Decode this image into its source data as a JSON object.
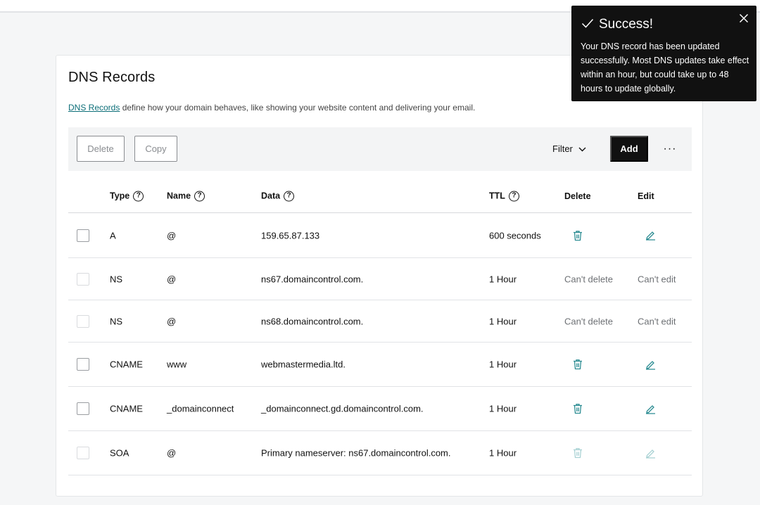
{
  "card": {
    "title": "DNS Records",
    "intro_link": "DNS Records",
    "intro_text": " define how your domain behaves, like showing your website content and delivering your email."
  },
  "toolbar": {
    "delete_label": "Delete",
    "copy_label": "Copy",
    "filter_label": "Filter",
    "add_label": "Add",
    "more_label": "···"
  },
  "table": {
    "headers": {
      "type": "Type",
      "name": "Name",
      "data": "Data",
      "ttl": "TTL",
      "delete": "Delete",
      "edit": "Edit"
    },
    "rows": [
      {
        "type": "A",
        "name": "@",
        "data": "159.65.87.133",
        "ttl": "600 seconds",
        "delete": "",
        "edit": ""
      },
      {
        "type": "NS",
        "name": "@",
        "data": "ns67.domaincontrol.com.",
        "ttl": "1 Hour",
        "delete": "Can't delete",
        "edit": "Can't edit"
      },
      {
        "type": "NS",
        "name": "@",
        "data": "ns68.domaincontrol.com.",
        "ttl": "1 Hour",
        "delete": "Can't delete",
        "edit": "Can't edit"
      },
      {
        "type": "CNAME",
        "name": "www",
        "data": "webmastermedia.ltd.",
        "ttl": "1 Hour",
        "delete": "",
        "edit": ""
      },
      {
        "type": "CNAME",
        "name": "_domainconnect",
        "data": "_domainconnect.gd.domaincontrol.com.",
        "ttl": "1 Hour",
        "delete": "",
        "edit": ""
      },
      {
        "type": "SOA",
        "name": "@",
        "data": "Primary nameserver: ns67.domaincontrol.com.",
        "ttl": "1 Hour",
        "delete": "",
        "edit": ""
      }
    ]
  },
  "toast": {
    "title": "Success!",
    "message": "Your DNS record has been updated successfully. Most DNS updates take effect within an hour, but could take up to 48 hours to update globally."
  },
  "colors": {
    "accent": "#0c6e78",
    "toast_bg": "#111111",
    "icon_teal": "#2b8c92",
    "icon_disabled": "#a9d2d4"
  },
  "icons": {
    "delete": "trash-icon",
    "edit": "pencil-icon",
    "help": "question-circle-icon",
    "filter": "chevron-down-icon",
    "toast_status": "check-icon",
    "toast_close": "close-icon"
  }
}
